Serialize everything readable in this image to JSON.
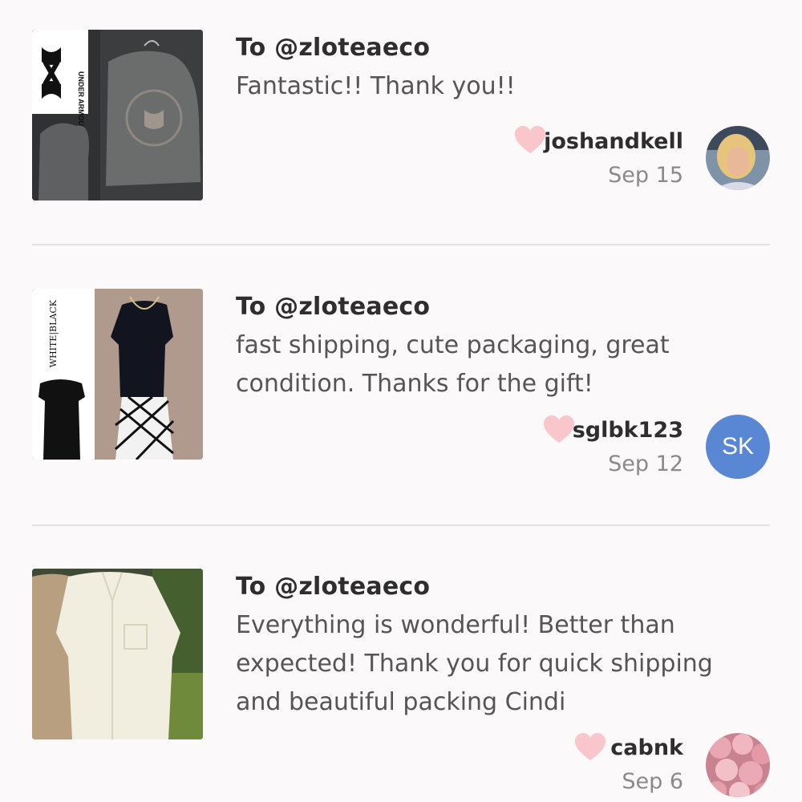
{
  "notes": [
    {
      "to": "To @zloteaeco",
      "message": "Fantastic!! Thank you!!",
      "username": "joshandkell",
      "date": "Sep 15",
      "thumb_brand": "UNDER ARMOUR",
      "thumb_brand_letters": "UNDER ARMOUR"
    },
    {
      "to": "To @zloteaeco",
      "message": "fast shipping, cute packaging, great condition. Thanks for the gift!",
      "username": "sglbk123",
      "date": "Sep 12",
      "avatar_initials": "SK",
      "thumb_brand": "WHITE|BLACK"
    },
    {
      "to": "To @zloteaeco",
      "message": "Everything is wonderful! Better than expected! Thank you for quick shipping and beautiful packing Cindi",
      "username": "cabnk",
      "date": "Sep 6"
    }
  ],
  "colors": {
    "heart": "#f8c6cb",
    "avatar_sk": "#5a87d3",
    "background": "#fbf9fa"
  },
  "icons": [
    "heart-icon"
  ]
}
